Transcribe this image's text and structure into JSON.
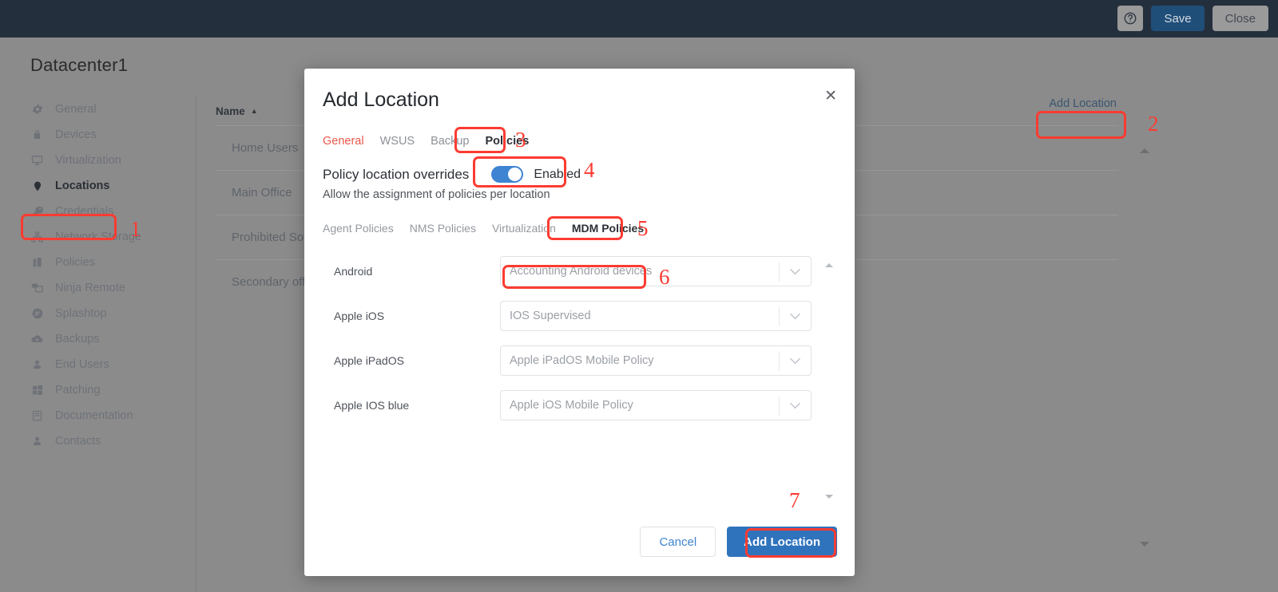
{
  "topbar": {
    "help_icon": "help-circle-icon",
    "save_label": "Save",
    "close_label": "Close"
  },
  "page": {
    "title": "Datacenter1",
    "add_location_label": "Add Location"
  },
  "sidebar": {
    "items": [
      {
        "label": "General",
        "icon": "gear-icon",
        "active": false
      },
      {
        "label": "Devices",
        "icon": "lock-icon",
        "active": false
      },
      {
        "label": "Virtualization",
        "icon": "monitor-icon",
        "active": false
      },
      {
        "label": "Locations",
        "icon": "map-pin-icon",
        "active": true
      },
      {
        "label": "Credentials",
        "icon": "key-icon",
        "active": false
      },
      {
        "label": "Network Storage",
        "icon": "network-icon",
        "active": false
      },
      {
        "label": "Policies",
        "icon": "briefcase-icon",
        "active": false
      },
      {
        "label": "Ninja Remote",
        "icon": "remote-screen-icon",
        "active": false
      },
      {
        "label": "Splashtop",
        "icon": "splashtop-icon",
        "active": false
      },
      {
        "label": "Backups",
        "icon": "cloud-upload-icon",
        "active": false
      },
      {
        "label": "End Users",
        "icon": "user-icon",
        "active": false
      },
      {
        "label": "Patching",
        "icon": "windows-icon",
        "active": false
      },
      {
        "label": "Documentation",
        "icon": "book-icon",
        "active": false
      },
      {
        "label": "Contacts",
        "icon": "user-icon",
        "active": false
      }
    ]
  },
  "table": {
    "column_header": "Name",
    "sort_caret": "▲",
    "rows": [
      {
        "name": "Home Users"
      },
      {
        "name": "Main Office"
      },
      {
        "name": "Prohibited Soft"
      },
      {
        "name": "Secondary offic"
      }
    ]
  },
  "modal": {
    "title": "Add Location",
    "close_icon": "close-icon",
    "tabs": [
      {
        "label": "General",
        "state": "current"
      },
      {
        "label": "WSUS",
        "state": "normal"
      },
      {
        "label": "Backup",
        "state": "normal"
      },
      {
        "label": "Policies",
        "state": "boxed"
      }
    ],
    "overrides": {
      "label": "Policy location overrides",
      "toggle_state": "on",
      "toggle_text": "Enabled",
      "description": "Allow the assignment of policies per location"
    },
    "subtabs": [
      {
        "label": "Agent Policies",
        "state": "normal"
      },
      {
        "label": "NMS Policies",
        "state": "normal"
      },
      {
        "label": "Virtualization",
        "state": "normal"
      },
      {
        "label": "MDM Policies",
        "state": "boxed"
      }
    ],
    "fields": [
      {
        "label": "Android",
        "value": "Accounting Android devices",
        "chevron": "chevron-down-icon"
      },
      {
        "label": "Apple iOS",
        "value": "IOS Supervised",
        "chevron": "chevron-down-icon"
      },
      {
        "label": "Apple iPadOS",
        "value": "Apple iPadOS Mobile Policy",
        "chevron": "chevron-down-icon"
      },
      {
        "label": "Apple IOS blue",
        "value": "Apple iOS Mobile Policy",
        "chevron": "chevron-down-icon"
      }
    ],
    "footer": {
      "cancel_label": "Cancel",
      "submit_label": "Add Location"
    }
  },
  "annotations": {
    "color": "#fc3b31",
    "markers": [
      {
        "number": "1",
        "target": "sidebar-item-locations"
      },
      {
        "number": "2",
        "target": "page-add-location-button"
      },
      {
        "number": "3",
        "target": "modal-tab-policies"
      },
      {
        "number": "4",
        "target": "policy-overrides-toggle"
      },
      {
        "number": "5",
        "target": "modal-subtab-mdm-policies"
      },
      {
        "number": "6",
        "target": "android-policy-select-value"
      },
      {
        "number": "7",
        "target": "modal-add-location-button"
      }
    ]
  }
}
